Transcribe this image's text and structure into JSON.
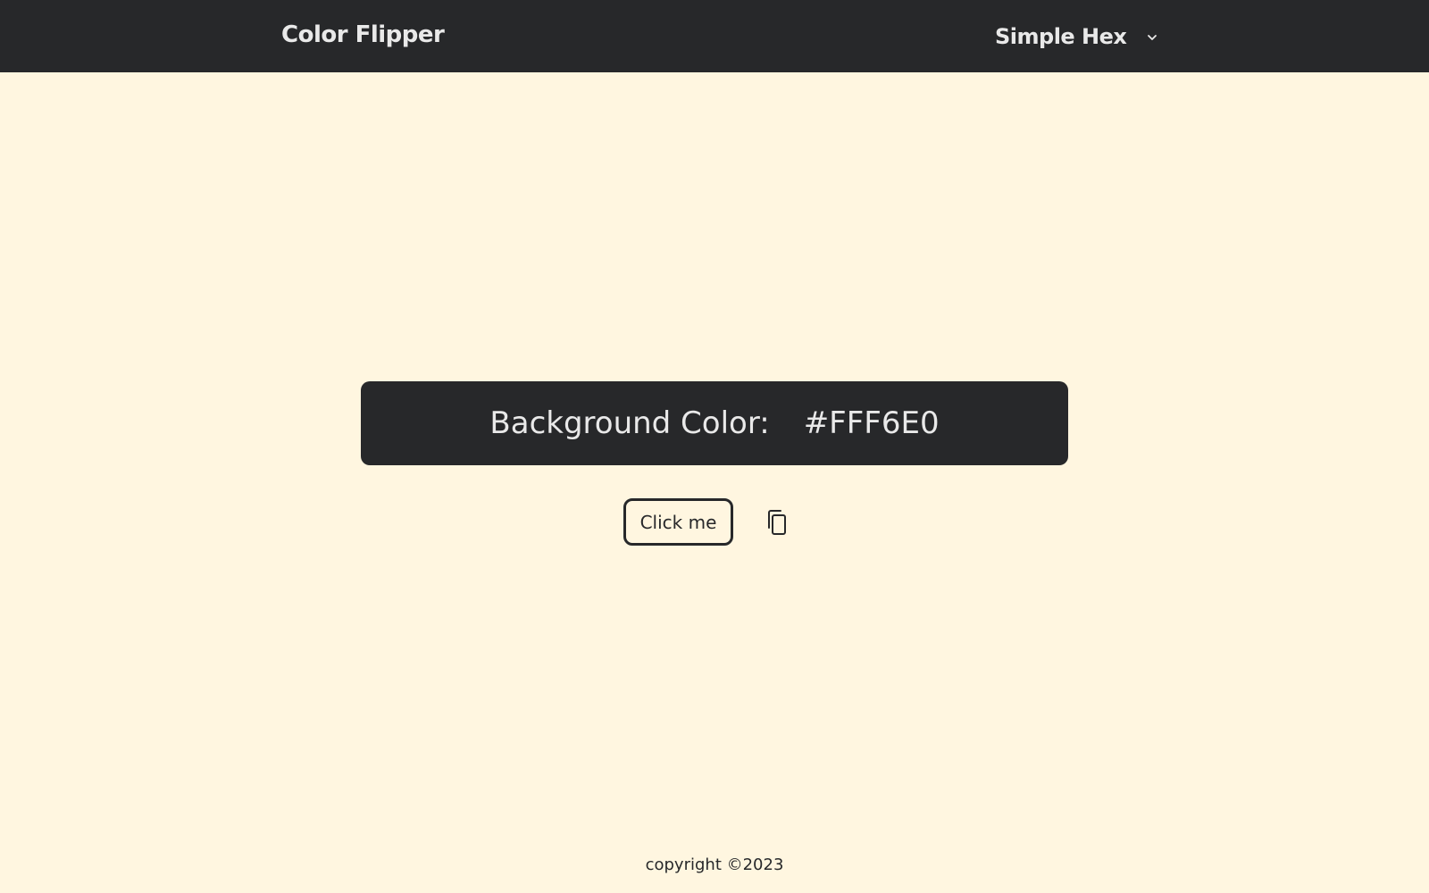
{
  "navbar": {
    "brand": "Color Flipper",
    "mode_select": {
      "selected": "Simple Hex",
      "icon": "chevron-down-icon"
    }
  },
  "main": {
    "color_label": "Background Color:",
    "color_value": "#FFF6E0",
    "click_button_label": "Click me",
    "copy_icon": "copy-icon"
  },
  "footer": {
    "copyright": "copyright ©2023"
  },
  "colors": {
    "background": "#FFF6E0",
    "navbar": "#27282a",
    "panel": "#27282a",
    "light_text": "#e9e9e9"
  }
}
